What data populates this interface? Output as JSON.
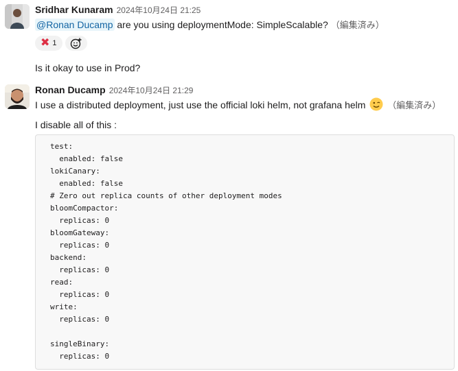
{
  "messages": [
    {
      "sender": "Sridhar Kunaram",
      "timestamp": "2024年10月24日 21:25",
      "mention": "@Ronan Ducamp",
      "text_after_mention": " are you using deploymentMode: SimpleScalable?",
      "edited": "（編集済み）",
      "reactions": [
        {
          "emoji": "cross-mark",
          "glyph": "✖",
          "count": "1"
        }
      ],
      "add_reaction_icon": "add-reaction-icon",
      "followup": "Is it okay to use in Prod?"
    },
    {
      "sender": "Ronan Ducamp",
      "timestamp": "2024年10月24日 21:29",
      "text": "I use a distributed deployment, just use the official loki helm, not grafana helm",
      "emoji": "wink-emoji",
      "edited": "（編集済み）",
      "line2": "I disable all of this :",
      "code": [
        "test:",
        "  enabled: false",
        "lokiCanary:",
        "  enabled: false",
        "# Zero out replica counts of other deployment modes",
        "bloomCompactor:",
        "  replicas: 0",
        "bloomGateway:",
        "  replicas: 0",
        "backend:",
        "  replicas: 0",
        "read:",
        "  replicas: 0",
        "write:",
        "  replicas: 0",
        "",
        "singleBinary:",
        "  replicas: 0"
      ]
    }
  ],
  "colors": {
    "mention_bg": "#e8f5fa",
    "mention_fg": "#1264a3",
    "reaction_bg": "#f2f2f2",
    "code_bg": "#f8f8f8",
    "cross": "#dd2e44"
  }
}
